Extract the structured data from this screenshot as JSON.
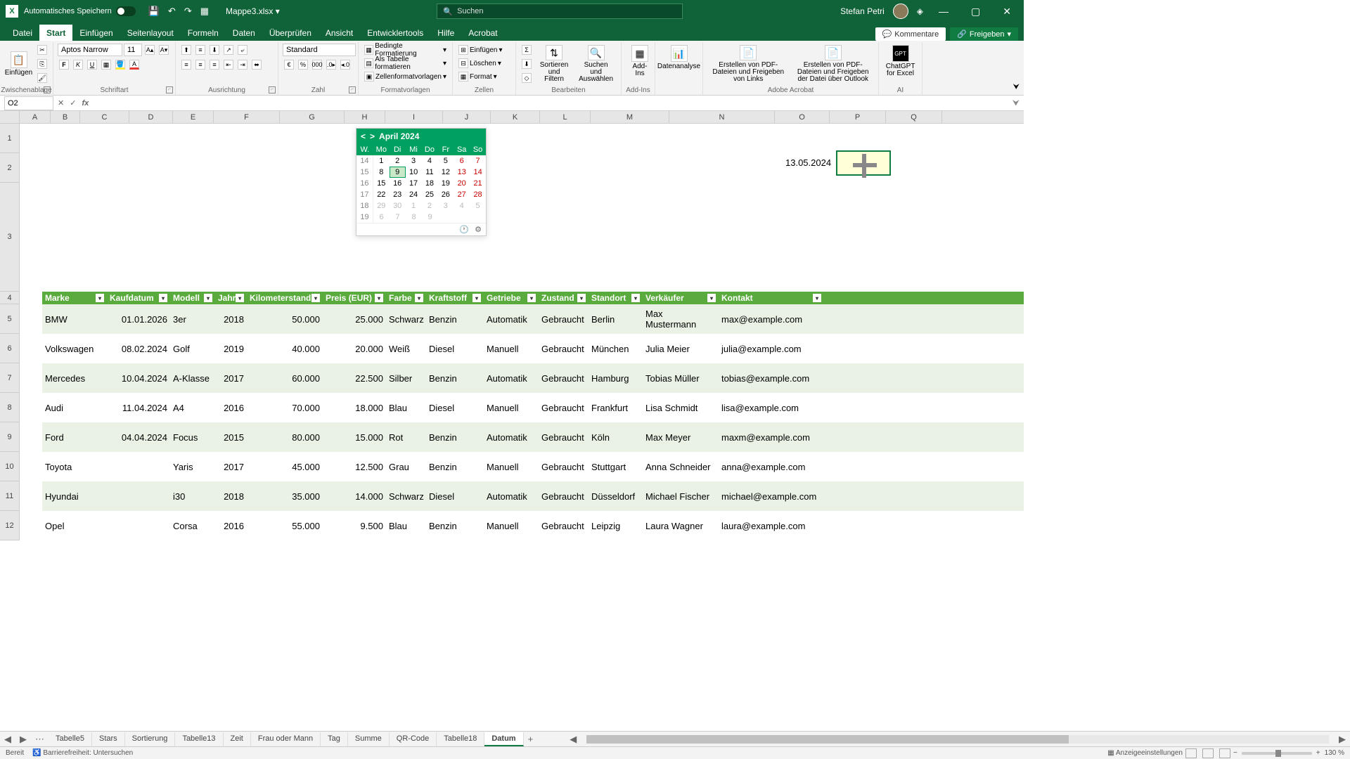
{
  "title": {
    "autosave": "Automatisches Speichern",
    "filename": "Mappe3.xlsx",
    "search": "Suchen",
    "user": "Stefan Petri"
  },
  "menu": {
    "items": [
      "Datei",
      "Start",
      "Einfügen",
      "Seitenlayout",
      "Formeln",
      "Daten",
      "Überprüfen",
      "Ansicht",
      "Entwicklertools",
      "Hilfe",
      "Acrobat"
    ],
    "active": 1,
    "comments": "Kommentare",
    "share": "Freigeben"
  },
  "ribbon": {
    "paste": "Einfügen",
    "clipboard": "Zwischenablage",
    "font_name": "Aptos Narrow",
    "font_size": "11",
    "schrift": "Schriftart",
    "ausrichtung": "Ausrichtung",
    "formatStd": "Standard",
    "zahl": "Zahl",
    "bedingte": "Bedingte Formatierung",
    "alsTabelle": "Als Tabelle formatieren",
    "zellenFormat": "Zellenformatvorlagen",
    "formatvorlagen": "Formatvorlagen",
    "einfuegen": "Einfügen",
    "loeschen": "Löschen",
    "format": "Format",
    "zellen": "Zellen",
    "sortieren": "Sortieren und Filtern",
    "suchen": "Suchen und Auswählen",
    "bearbeiten": "Bearbeiten",
    "addins": "Add-Ins",
    "addins_grp": "Add-Ins",
    "daten": "Datenanalyse",
    "pdf1": "Erstellen von PDF-Dateien und Freigeben von Links",
    "pdf2": "Erstellen von PDF-Dateien und Freigeben der Datei über Outlook",
    "adobe": "Adobe Acrobat",
    "gpt": "ChatGPT for Excel",
    "ai": "AI"
  },
  "fbar": {
    "name": "O2",
    "formula": ""
  },
  "cols": [
    "A",
    "B",
    "C",
    "D",
    "E",
    "F",
    "G",
    "H",
    "I",
    "J",
    "K",
    "L",
    "M",
    "N",
    "O",
    "P",
    "Q"
  ],
  "row_headers": [
    "1",
    "2",
    "3",
    "4",
    "5",
    "6",
    "7",
    "8",
    "9",
    "10",
    "11",
    "12"
  ],
  "calendar": {
    "title": "April 2024",
    "prev": "<",
    "next": ">",
    "dh": [
      "W.",
      "Mo",
      "Di",
      "Mi",
      "Do",
      "Fr",
      "Sa",
      "So"
    ],
    "weeks": [
      {
        "wk": "14",
        "days": [
          "1",
          "2",
          "3",
          "4",
          "5",
          "6",
          "7"
        ]
      },
      {
        "wk": "15",
        "days": [
          "8",
          "9",
          "10",
          "11",
          "12",
          "13",
          "14"
        ]
      },
      {
        "wk": "16",
        "days": [
          "15",
          "16",
          "17",
          "18",
          "19",
          "20",
          "21"
        ]
      },
      {
        "wk": "17",
        "days": [
          "22",
          "23",
          "24",
          "25",
          "26",
          "27",
          "28"
        ]
      },
      {
        "wk": "18",
        "days": [
          "29",
          "30",
          "1",
          "2",
          "3",
          "4",
          "5"
        ]
      },
      {
        "wk": "19",
        "days": [
          "6",
          "7",
          "8",
          "9",
          "",
          ""
        ]
      }
    ],
    "today_row": 1,
    "today_col": 1
  },
  "date_cell": "13.05.2024",
  "table": {
    "headers": [
      "Marke",
      "Kaufdatum",
      "Modell",
      "Jahr",
      "Kilometerstand",
      "Preis (EUR)",
      "Farbe",
      "Kraftstoff",
      "Getriebe",
      "Zustand",
      "Standort",
      "Verkäufer",
      "Kontakt"
    ],
    "widths": [
      92,
      90,
      64,
      45,
      108,
      90,
      57,
      82,
      78,
      71,
      77,
      108,
      150
    ],
    "rows": [
      [
        "BMW",
        "01.01.2026",
        "3er",
        "2018",
        "50.000",
        "25.000",
        "Schwarz",
        "Benzin",
        "Automatik",
        "Gebraucht",
        "Berlin",
        "Max Mustermann",
        "max@example.com"
      ],
      [
        "Volkswagen",
        "08.02.2024",
        "Golf",
        "2019",
        "40.000",
        "20.000",
        "Weiß",
        "Diesel",
        "Manuell",
        "Gebraucht",
        "München",
        "Julia Meier",
        "julia@example.com"
      ],
      [
        "Mercedes",
        "10.04.2024",
        "A-Klasse",
        "2017",
        "60.000",
        "22.500",
        "Silber",
        "Benzin",
        "Automatik",
        "Gebraucht",
        "Hamburg",
        "Tobias Müller",
        "tobias@example.com"
      ],
      [
        "Audi",
        "11.04.2024",
        "A4",
        "2016",
        "70.000",
        "18.000",
        "Blau",
        "Diesel",
        "Manuell",
        "Gebraucht",
        "Frankfurt",
        "Lisa Schmidt",
        "lisa@example.com"
      ],
      [
        "Ford",
        "04.04.2024",
        "Focus",
        "2015",
        "80.000",
        "15.000",
        "Rot",
        "Benzin",
        "Automatik",
        "Gebraucht",
        "Köln",
        "Max Meyer",
        "maxm@example.com"
      ],
      [
        "Toyota",
        "",
        "Yaris",
        "2017",
        "45.000",
        "12.500",
        "Grau",
        "Benzin",
        "Manuell",
        "Gebraucht",
        "Stuttgart",
        "Anna Schneider",
        "anna@example.com"
      ],
      [
        "Hyundai",
        "",
        "i30",
        "2018",
        "35.000",
        "14.000",
        "Schwarz",
        "Diesel",
        "Automatik",
        "Gebraucht",
        "Düsseldorf",
        "Michael Fischer",
        "michael@example.com"
      ],
      [
        "Opel",
        "",
        "Corsa",
        "2016",
        "55.000",
        "9.500",
        "Blau",
        "Benzin",
        "Manuell",
        "Gebraucht",
        "Leipzig",
        "Laura Wagner",
        "laura@example.com"
      ]
    ]
  },
  "sheets": {
    "tabs": [
      "Tabelle5",
      "Stars",
      "Sortierung",
      "Tabelle13",
      "Zeit",
      "Frau oder Mann",
      "Tag",
      "Summe",
      "QR-Code",
      "Tabelle18",
      "Datum"
    ],
    "active": 10,
    "add": "+"
  },
  "status": {
    "ready": "Bereit",
    "access": "Barrierefreiheit: Untersuchen",
    "anzeige": "Anzeigeeinstellungen",
    "zoom": "130 %"
  }
}
